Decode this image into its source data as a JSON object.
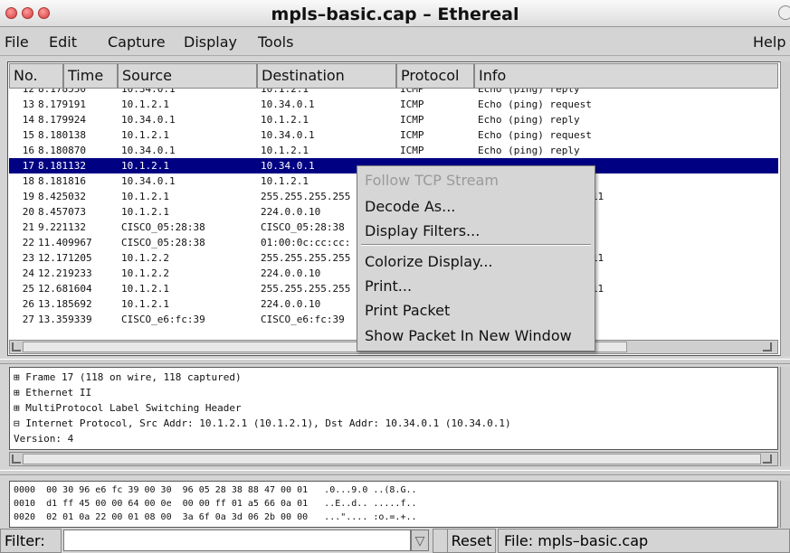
{
  "window": {
    "title": "mpls–basic.cap – Ethereal"
  },
  "menu": {
    "file": "File",
    "edit": "Edit",
    "capture": "Capture",
    "display": "Display",
    "tools": "Tools",
    "help": "Help"
  },
  "columns": [
    "No.",
    "Time",
    "Source",
    "Destination",
    "Protocol",
    "Info"
  ],
  "packets": [
    {
      "no": "12",
      "time": "8.178550",
      "src": "10.34.0.1",
      "dst": "10.1.2.1",
      "proto": "ICMP",
      "info": "Echo (ping) reply"
    },
    {
      "no": "13",
      "time": "8.179191",
      "src": "10.1.2.1",
      "dst": "10.34.0.1",
      "proto": "ICMP",
      "info": "Echo (ping) request"
    },
    {
      "no": "14",
      "time": "8.179924",
      "src": "10.34.0.1",
      "dst": "10.1.2.1",
      "proto": "ICMP",
      "info": "Echo (ping) reply"
    },
    {
      "no": "15",
      "time": "8.180138",
      "src": "10.1.2.1",
      "dst": "10.34.0.1",
      "proto": "ICMP",
      "info": "Echo (ping) request"
    },
    {
      "no": "16",
      "time": "8.180870",
      "src": "10.34.0.1",
      "dst": "10.1.2.1",
      "proto": "ICMP",
      "info": "Echo (ping) reply"
    },
    {
      "no": "17",
      "time": "8.181132",
      "src": "10.1.2.1",
      "dst": "10.34.0.1",
      "proto": "",
      "info": ""
    },
    {
      "no": "18",
      "time": "8.181816",
      "src": "10.34.0.1",
      "dst": "10.1.2.1",
      "proto": "",
      "info": ""
    },
    {
      "no": "19",
      "time": "8.425032",
      "src": "10.1.2.1",
      "dst": "255.255.255.255",
      "proto": "",
      "info": "lestination port: 711"
    },
    {
      "no": "20",
      "time": "8.457073",
      "src": "10.1.2.1",
      "dst": "224.0.0.10",
      "proto": "",
      "info": ""
    },
    {
      "no": "21",
      "time": "9.221132",
      "src": "CISCO_05:28:38",
      "dst": "CISCO_05:28:38",
      "proto": "",
      "info": ""
    },
    {
      "no": "22",
      "time": "11.409967",
      "src": "CISCO_05:28:38",
      "dst": "01:00:0c:cc:cc:",
      "proto": "",
      "info": "otocol"
    },
    {
      "no": "23",
      "time": "12.171205",
      "src": "10.1.2.2",
      "dst": "255.255.255.255",
      "proto": "",
      "info": "lestination port: 711"
    },
    {
      "no": "24",
      "time": "12.219233",
      "src": "10.1.2.2",
      "dst": "224.0.0.10",
      "proto": "",
      "info": ""
    },
    {
      "no": "25",
      "time": "12.681604",
      "src": "10.1.2.1",
      "dst": "255.255.255.255",
      "proto": "",
      "info": "lestination port: 711"
    },
    {
      "no": "26",
      "time": "13.185692",
      "src": "10.1.2.1",
      "dst": "224.0.0.10",
      "proto": "",
      "info": ""
    },
    {
      "no": "27",
      "time": "13.359339",
      "src": "CISCO_e6:fc:39",
      "dst": "CISCO_e6:fc:39",
      "proto": "",
      "info": ""
    }
  ],
  "context_menu": {
    "follow_tcp": "Follow TCP Stream",
    "decode_as": "Decode As...",
    "display_filters": "Display Filters...",
    "colorize": "Colorize Display...",
    "print": "Print...",
    "print_packet": "Print Packet",
    "show_packet": "Show Packet In New Window"
  },
  "details": [
    "⊞ Frame 17 (118 on wire, 118 captured)",
    "⊞ Ethernet II",
    "⊞ MultiProtocol Label Switching Header",
    "⊟ Internet Protocol, Src Addr: 10.1.2.1 (10.1.2.1), Dst Addr: 10.34.0.1 (10.34.0.1)",
    "    Version: 4"
  ],
  "hex": [
    "0000  00 30 96 e6 fc 39 00 30  96 05 28 38 88 47 00 01   .0...9.0 ..(8.G..",
    "0010  d1 ff 45 00 00 64 00 0e  00 00 ff 01 a5 66 0a 01   ..E..d.. .....f..",
    "0020  02 01 0a 22 00 01 08 00  3a 6f 0a 3d 06 2b 00 00   ...\".... :o.=.+.."
  ],
  "statusbar": {
    "filter_label": "Filter:",
    "filter_value": "",
    "reset": "Reset",
    "file": "File: mpls–basic.cap"
  },
  "colors": {
    "selection": "#000082",
    "background": "#d4d4d4"
  }
}
